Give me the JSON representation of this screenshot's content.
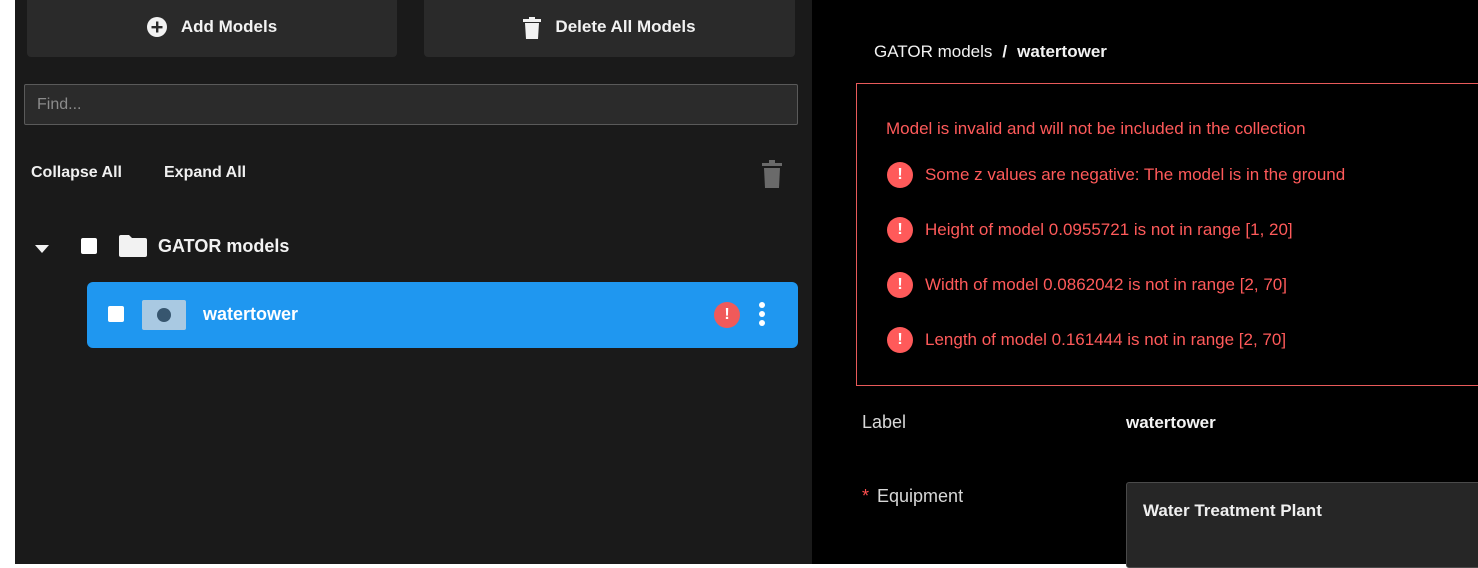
{
  "left": {
    "add_models_label": "Add Models",
    "delete_all_label": "Delete All Models",
    "find_placeholder": "Find...",
    "collapse_all_label": "Collapse All",
    "expand_all_label": "Expand All",
    "tree": {
      "root_label": "GATOR models",
      "model_label": "watertower",
      "model_error_mark": "!"
    }
  },
  "right": {
    "breadcrumb": {
      "root": "GATOR models",
      "separator": "/",
      "current": "watertower"
    },
    "errors": {
      "title": "Model is invalid and will not be included in the collection",
      "icon_glyph": "!",
      "items": [
        "Some z values are negative: The model is in the ground",
        "Height of model 0.0955721 is not in range [1, 20]",
        "Width of model 0.0862042 is not in range [2, 70]",
        "Length of model 0.161444 is not in range [2, 70]"
      ]
    },
    "label_field": {
      "label": "Label",
      "value": "watertower"
    },
    "equipment_field": {
      "required_mark": "*",
      "label": "Equipment",
      "value": "Water Treatment Plant"
    }
  },
  "colors": {
    "selected_row": "#1f97f0",
    "error": "#ff5a5a",
    "panel_bg": "#1a1a1a"
  }
}
